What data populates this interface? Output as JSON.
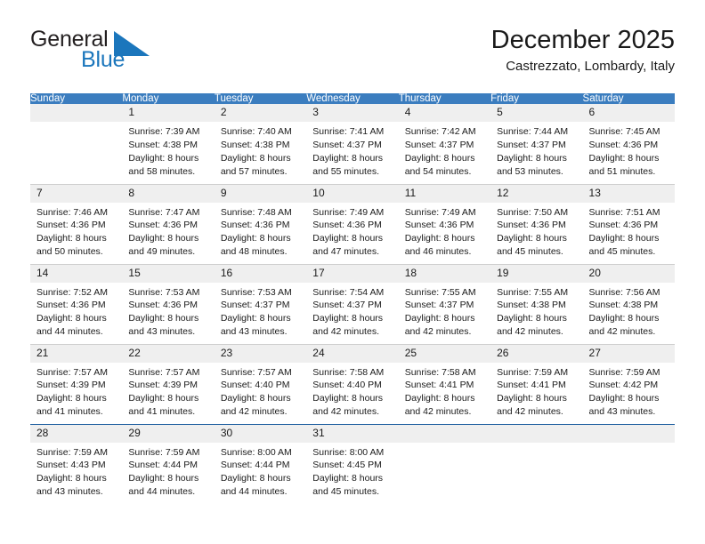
{
  "brand": {
    "name_part1": "General",
    "name_part2": "Blue",
    "triangle_color": "#1b76bc",
    "text_color": "#231f20"
  },
  "header": {
    "title": "December 2025",
    "subtitle": "Castrezzato, Lombardy, Italy"
  },
  "theme": {
    "header_bg": "#3b7dbf",
    "daynum_bg": "#efefef",
    "grid_line": "#cfcfcf",
    "accent_line": "#1f5fa0"
  },
  "weekday_headers": [
    "Sunday",
    "Monday",
    "Tuesday",
    "Wednesday",
    "Thursday",
    "Friday",
    "Saturday"
  ],
  "labels": {
    "sunrise_prefix": "Sunrise: ",
    "sunset_prefix": "Sunset: ",
    "daylight_prefix": "Daylight: "
  },
  "weeks": [
    [
      {
        "day": "",
        "empty": true
      },
      {
        "day": "1",
        "sunrise": "Sunrise: 7:39 AM",
        "sunset": "Sunset: 4:38 PM",
        "daylight_line1": "Daylight: 8 hours",
        "daylight_line2": "and 58 minutes."
      },
      {
        "day": "2",
        "sunrise": "Sunrise: 7:40 AM",
        "sunset": "Sunset: 4:38 PM",
        "daylight_line1": "Daylight: 8 hours",
        "daylight_line2": "and 57 minutes."
      },
      {
        "day": "3",
        "sunrise": "Sunrise: 7:41 AM",
        "sunset": "Sunset: 4:37 PM",
        "daylight_line1": "Daylight: 8 hours",
        "daylight_line2": "and 55 minutes."
      },
      {
        "day": "4",
        "sunrise": "Sunrise: 7:42 AM",
        "sunset": "Sunset: 4:37 PM",
        "daylight_line1": "Daylight: 8 hours",
        "daylight_line2": "and 54 minutes."
      },
      {
        "day": "5",
        "sunrise": "Sunrise: 7:44 AM",
        "sunset": "Sunset: 4:37 PM",
        "daylight_line1": "Daylight: 8 hours",
        "daylight_line2": "and 53 minutes."
      },
      {
        "day": "6",
        "sunrise": "Sunrise: 7:45 AM",
        "sunset": "Sunset: 4:36 PM",
        "daylight_line1": "Daylight: 8 hours",
        "daylight_line2": "and 51 minutes."
      }
    ],
    [
      {
        "day": "7",
        "sunrise": "Sunrise: 7:46 AM",
        "sunset": "Sunset: 4:36 PM",
        "daylight_line1": "Daylight: 8 hours",
        "daylight_line2": "and 50 minutes."
      },
      {
        "day": "8",
        "sunrise": "Sunrise: 7:47 AM",
        "sunset": "Sunset: 4:36 PM",
        "daylight_line1": "Daylight: 8 hours",
        "daylight_line2": "and 49 minutes."
      },
      {
        "day": "9",
        "sunrise": "Sunrise: 7:48 AM",
        "sunset": "Sunset: 4:36 PM",
        "daylight_line1": "Daylight: 8 hours",
        "daylight_line2": "and 48 minutes."
      },
      {
        "day": "10",
        "sunrise": "Sunrise: 7:49 AM",
        "sunset": "Sunset: 4:36 PM",
        "daylight_line1": "Daylight: 8 hours",
        "daylight_line2": "and 47 minutes."
      },
      {
        "day": "11",
        "sunrise": "Sunrise: 7:49 AM",
        "sunset": "Sunset: 4:36 PM",
        "daylight_line1": "Daylight: 8 hours",
        "daylight_line2": "and 46 minutes."
      },
      {
        "day": "12",
        "sunrise": "Sunrise: 7:50 AM",
        "sunset": "Sunset: 4:36 PM",
        "daylight_line1": "Daylight: 8 hours",
        "daylight_line2": "and 45 minutes."
      },
      {
        "day": "13",
        "sunrise": "Sunrise: 7:51 AM",
        "sunset": "Sunset: 4:36 PM",
        "daylight_line1": "Daylight: 8 hours",
        "daylight_line2": "and 45 minutes."
      }
    ],
    [
      {
        "day": "14",
        "sunrise": "Sunrise: 7:52 AM",
        "sunset": "Sunset: 4:36 PM",
        "daylight_line1": "Daylight: 8 hours",
        "daylight_line2": "and 44 minutes."
      },
      {
        "day": "15",
        "sunrise": "Sunrise: 7:53 AM",
        "sunset": "Sunset: 4:36 PM",
        "daylight_line1": "Daylight: 8 hours",
        "daylight_line2": "and 43 minutes."
      },
      {
        "day": "16",
        "sunrise": "Sunrise: 7:53 AM",
        "sunset": "Sunset: 4:37 PM",
        "daylight_line1": "Daylight: 8 hours",
        "daylight_line2": "and 43 minutes."
      },
      {
        "day": "17",
        "sunrise": "Sunrise: 7:54 AM",
        "sunset": "Sunset: 4:37 PM",
        "daylight_line1": "Daylight: 8 hours",
        "daylight_line2": "and 42 minutes."
      },
      {
        "day": "18",
        "sunrise": "Sunrise: 7:55 AM",
        "sunset": "Sunset: 4:37 PM",
        "daylight_line1": "Daylight: 8 hours",
        "daylight_line2": "and 42 minutes."
      },
      {
        "day": "19",
        "sunrise": "Sunrise: 7:55 AM",
        "sunset": "Sunset: 4:38 PM",
        "daylight_line1": "Daylight: 8 hours",
        "daylight_line2": "and 42 minutes."
      },
      {
        "day": "20",
        "sunrise": "Sunrise: 7:56 AM",
        "sunset": "Sunset: 4:38 PM",
        "daylight_line1": "Daylight: 8 hours",
        "daylight_line2": "and 42 minutes."
      }
    ],
    [
      {
        "day": "21",
        "sunrise": "Sunrise: 7:57 AM",
        "sunset": "Sunset: 4:39 PM",
        "daylight_line1": "Daylight: 8 hours",
        "daylight_line2": "and 41 minutes."
      },
      {
        "day": "22",
        "sunrise": "Sunrise: 7:57 AM",
        "sunset": "Sunset: 4:39 PM",
        "daylight_line1": "Daylight: 8 hours",
        "daylight_line2": "and 41 minutes."
      },
      {
        "day": "23",
        "sunrise": "Sunrise: 7:57 AM",
        "sunset": "Sunset: 4:40 PM",
        "daylight_line1": "Daylight: 8 hours",
        "daylight_line2": "and 42 minutes."
      },
      {
        "day": "24",
        "sunrise": "Sunrise: 7:58 AM",
        "sunset": "Sunset: 4:40 PM",
        "daylight_line1": "Daylight: 8 hours",
        "daylight_line2": "and 42 minutes."
      },
      {
        "day": "25",
        "sunrise": "Sunrise: 7:58 AM",
        "sunset": "Sunset: 4:41 PM",
        "daylight_line1": "Daylight: 8 hours",
        "daylight_line2": "and 42 minutes."
      },
      {
        "day": "26",
        "sunrise": "Sunrise: 7:59 AM",
        "sunset": "Sunset: 4:41 PM",
        "daylight_line1": "Daylight: 8 hours",
        "daylight_line2": "and 42 minutes."
      },
      {
        "day": "27",
        "sunrise": "Sunrise: 7:59 AM",
        "sunset": "Sunset: 4:42 PM",
        "daylight_line1": "Daylight: 8 hours",
        "daylight_line2": "and 43 minutes."
      }
    ],
    [
      {
        "day": "28",
        "sunrise": "Sunrise: 7:59 AM",
        "sunset": "Sunset: 4:43 PM",
        "daylight_line1": "Daylight: 8 hours",
        "daylight_line2": "and 43 minutes."
      },
      {
        "day": "29",
        "sunrise": "Sunrise: 7:59 AM",
        "sunset": "Sunset: 4:44 PM",
        "daylight_line1": "Daylight: 8 hours",
        "daylight_line2": "and 44 minutes."
      },
      {
        "day": "30",
        "sunrise": "Sunrise: 8:00 AM",
        "sunset": "Sunset: 4:44 PM",
        "daylight_line1": "Daylight: 8 hours",
        "daylight_line2": "and 44 minutes."
      },
      {
        "day": "31",
        "sunrise": "Sunrise: 8:00 AM",
        "sunset": "Sunset: 4:45 PM",
        "daylight_line1": "Daylight: 8 hours",
        "daylight_line2": "and 45 minutes."
      },
      {
        "day": "",
        "empty": true
      },
      {
        "day": "",
        "empty": true
      },
      {
        "day": "",
        "empty": true
      }
    ]
  ]
}
